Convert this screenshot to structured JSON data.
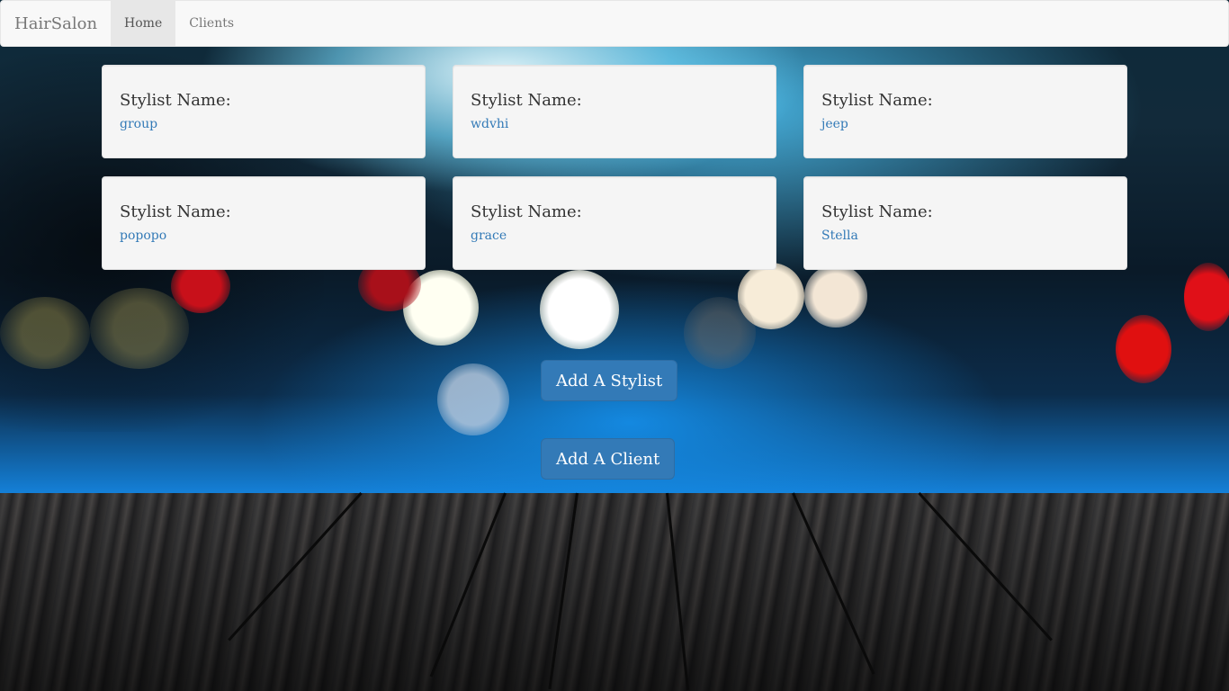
{
  "navbar": {
    "brand": "HairSalon",
    "items": [
      {
        "label": "Home",
        "active": true
      },
      {
        "label": "Clients",
        "active": false
      }
    ]
  },
  "stylists": {
    "label": "Stylist Name:",
    "names": [
      "group",
      "wdvhi",
      "jeep",
      "popopo",
      "grace",
      "Stella"
    ]
  },
  "actions": {
    "add_stylist": "Add A Stylist",
    "add_client": "Add A Client"
  },
  "colors": {
    "primary": "#337ab7",
    "link": "#337ab7",
    "navbar_bg": "#f8f8f8"
  }
}
